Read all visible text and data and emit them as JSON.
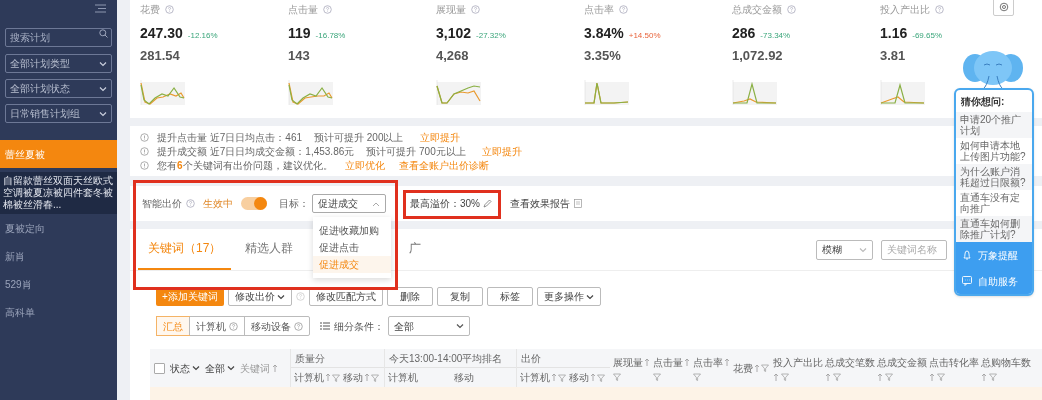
{
  "sidebar": {
    "search": {
      "placeholder": "搜索计划"
    },
    "filters": [
      {
        "label": "全部计划类型"
      },
      {
        "label": "全部计划状态"
      },
      {
        "label": "日常销售计划组"
      }
    ],
    "items": [
      {
        "label": "蕾丝夏被",
        "kind": "group",
        "selected": true
      },
      {
        "label": "自留款蕾丝双面天丝欧式空调被夏凉被四件套冬被棉被丝滑春...",
        "kind": "plan",
        "selected": false
      },
      {
        "label": "夏被定向",
        "kind": "group",
        "selected": false
      },
      {
        "label": "新肖",
        "kind": "group",
        "selected": false
      },
      {
        "label": "529肖",
        "kind": "group",
        "selected": false
      },
      {
        "label": "高科单",
        "kind": "group",
        "selected": false
      }
    ]
  },
  "metrics": [
    {
      "label": "花费",
      "value": "247.30",
      "change": "-12.16%",
      "increase": false,
      "previous": "281.54"
    },
    {
      "label": "点击量",
      "value": "119",
      "change": "-16.78%",
      "increase": false,
      "previous": "143"
    },
    {
      "label": "展现量",
      "value": "3,102",
      "change": "-27.32%",
      "increase": false,
      "previous": "4,268"
    },
    {
      "label": "点击率",
      "value": "3.84%",
      "change": "+14.50%",
      "increase": true,
      "previous": "3.35%"
    },
    {
      "label": "总成交金额",
      "value": "286",
      "change": "-73.34%",
      "increase": false,
      "previous": "1,072.92"
    },
    {
      "label": "投入产出比",
      "value": "1.16",
      "change": "-69.65%",
      "increase": false,
      "previous": "3.81"
    }
  ],
  "tips": [
    {
      "text": "提升点击量 近7日日均点击：461",
      "estimate": "预计可提升 200以上",
      "links": [
        "立即提升"
      ]
    },
    {
      "text": "提升成交额 近7日日均成交金额：1,453.86元",
      "estimate": "预计可提升 700元以上",
      "links": [
        "立即提升"
      ]
    },
    {
      "text": "您有**6**个关键词有出价问题，建议优化。",
      "links": [
        "立即优化",
        "查看全账户出价诊断"
      ]
    }
  ],
  "smart_bid": {
    "label": "智能出价",
    "status": "生效中",
    "on": true,
    "goal_label": "目标：",
    "goal": "促进成交",
    "expanded": true,
    "options": [
      {
        "label": "促进收藏加购",
        "selected": false
      },
      {
        "label": "促进点击",
        "selected": false
      },
      {
        "label": "促进成交",
        "selected": true
      }
    ],
    "max_premium": "最高溢价：30%",
    "report_link": "查看效果报告"
  },
  "tabs": [
    {
      "label": "关键词（17）",
      "selected": true
    },
    {
      "label": "精选人群",
      "selected": false
    },
    {
      "label": "广",
      "selected": false
    }
  ],
  "match_select": "模糊",
  "keyword_search": {
    "placeholder": "关键词名称"
  },
  "actions": [
    {
      "label": "+添加关键词",
      "kind": "primary"
    },
    {
      "label": "修改出价",
      "kind": "menu"
    },
    {
      "kind": "help"
    },
    {
      "label": "修改匹配方式",
      "kind": "plain"
    },
    {
      "label": "删除",
      "kind": "plain"
    },
    {
      "label": "复制",
      "kind": "plain"
    },
    {
      "label": "标签",
      "kind": "plain"
    },
    {
      "label": "更多操作",
      "kind": "menu"
    }
  ],
  "device_tabs": [
    {
      "label": "汇总",
      "help": false,
      "selected": true
    },
    {
      "label": "计算机",
      "help": true,
      "selected": false
    },
    {
      "label": "移动设备",
      "help": true,
      "selected": false
    }
  ],
  "segment": {
    "label": "细分条件：",
    "value": "全部"
  },
  "table": {
    "select_all_checked": false,
    "lead": [
      {
        "label": "状态",
        "kind": "menu"
      },
      {
        "label": "全部",
        "kind": "menu"
      },
      {
        "label": "关键词",
        "kind": "sort"
      }
    ],
    "groups": [
      {
        "label": "质量分",
        "subs": [
          {
            "label": "计算机",
            "sort": true,
            "filter": true
          },
          {
            "label": "移动",
            "sort": true,
            "filter": true
          }
        ]
      },
      {
        "label": "今天13:00-14:00平均排名",
        "subs": [
          {
            "label": "计算机",
            "sort": false,
            "filter": false
          },
          {
            "label": "移动",
            "sort": false,
            "filter": false
          }
        ]
      },
      {
        "label": "出价",
        "subs": [
          {
            "label": "计算机",
            "sort": true,
            "filter": true
          },
          {
            "label": "移动",
            "sort": true,
            "filter": true
          }
        ]
      }
    ],
    "columns": [
      {
        "label": "展现量",
        "sort": true,
        "filter": true,
        "stacked": true
      },
      {
        "label": "点击量",
        "sort": true,
        "filter": true,
        "stacked": true
      },
      {
        "label": "点击率",
        "sort": true,
        "filter": true,
        "stacked": true
      },
      {
        "label": "花费",
        "sort": true,
        "filter": true,
        "stacked": false
      },
      {
        "label": "投入产出比",
        "sort": true,
        "filter": true,
        "stacked": true
      },
      {
        "label": "总成交笔数",
        "sort": true,
        "filter": true,
        "stacked": true
      },
      {
        "label": "总成交金额",
        "sort": true,
        "filter": true,
        "stacked": true
      },
      {
        "label": "点击转化率",
        "sort": true,
        "filter": true,
        "stacked": true
      },
      {
        "label": "总购物车数",
        "sort": true,
        "filter": true,
        "stacked": true
      }
    ]
  },
  "helper": {
    "title": "猜你想问:",
    "questions": [
      "申请20个推广计划",
      "如何申请本地上传图片功能?",
      "为什么账户消耗超过日限额?",
      "直通车没有定向推广",
      "直通车如何删除推广计划?"
    ],
    "actions": [
      {
        "label": "万象提醒",
        "kind": "bell"
      },
      {
        "label": "自助服务",
        "kind": "chat"
      }
    ]
  }
}
